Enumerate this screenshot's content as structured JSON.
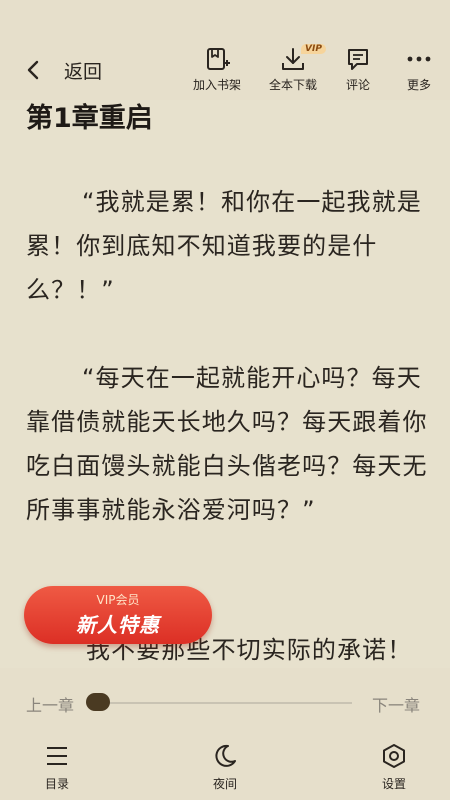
{
  "topbar": {
    "back_label": "返回",
    "tools": {
      "bookshelf": "加入书架",
      "download": "全本下载",
      "download_badge": "VIP",
      "comment": "评论",
      "more": "更多"
    }
  },
  "content": {
    "chapter_title": "第1章重启",
    "paragraphs": [
      "“我就是累！和你在一起我就是累！你到底知不知道我要的是什么？！”",
      "“每天在一起就能开心吗？每天靠借债就能天长地久吗？每天跟着你吃白面馒头就能白头偕老吗？每天无所事事就能永浴爱河吗？”",
      "我不要那些不切实际的承诺！"
    ]
  },
  "vip_badge": {
    "small": "VIP会员",
    "big": "新人特惠"
  },
  "progress": {
    "prev_label": "上一章",
    "next_label": "下一章",
    "value": 0
  },
  "bottom_nav": {
    "catalog": "目录",
    "night": "夜间",
    "settings": "设置"
  },
  "colors": {
    "background": "#e7e1cd",
    "text": "#2a2520",
    "badge": "#e0382a",
    "knob": "#4a3a22"
  }
}
